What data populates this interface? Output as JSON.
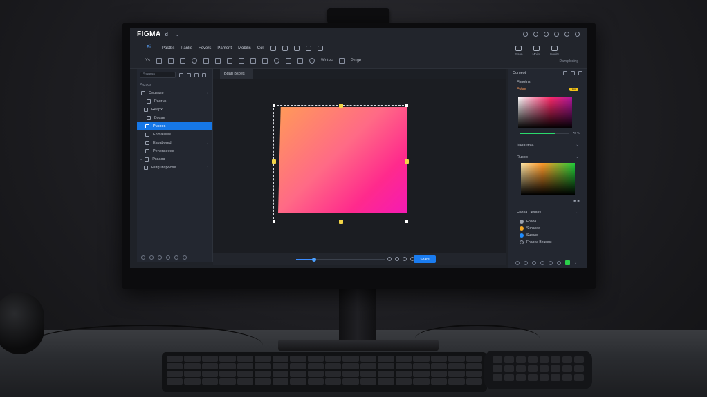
{
  "app": {
    "title": "FIGMA",
    "title_suffix": "d",
    "window_caret": "⌄"
  },
  "toolbar": {
    "home_label": "Fi",
    "menus": [
      "Pastbs",
      "Panlie",
      "Fovers",
      "Pament",
      "Mobilis",
      "Coli"
    ],
    "right_tools": [
      {
        "label": "Prson"
      },
      {
        "label": "Moiss"
      },
      {
        "label": "Nouits"
      }
    ],
    "tool_text_1": "Ys",
    "tool_text_2": "Wotes",
    "tool_text_3": "Pluge",
    "status": "Damiplosing"
  },
  "left_panel": {
    "search_placeholder": "Sseeaa",
    "layers": [
      {
        "label": "Pozoos",
        "selected": false
      },
      {
        "label": "Coucace",
        "selected": false
      },
      {
        "label": "Paorus",
        "selected": false
      },
      {
        "label": "Reapx",
        "selected": false
      },
      {
        "label": "Bosae",
        "selected": false
      },
      {
        "label": "Pucoes",
        "selected": true
      },
      {
        "label": "Ehmauses",
        "selected": false
      },
      {
        "label": "Espabored",
        "selected": false
      },
      {
        "label": "Penonseees",
        "selected": false
      },
      {
        "label": "Pssaoa",
        "selected": false
      },
      {
        "label": "Purgunspoose",
        "selected": false
      }
    ]
  },
  "canvas": {
    "tab_label": "Bdad Bsoes",
    "share_label": "Share",
    "zoom": 0.2
  },
  "right_panel": {
    "header": "Comeot",
    "section_fill": "Fimotns",
    "fill_sub": "Folse",
    "fill_badge": "Fill",
    "picker1_value": "70 %",
    "section_2": "Inunrneca",
    "section_3": "Rucoo",
    "picker2_value": "◉ ◉",
    "section_4": "Fuosa Desass",
    "swatches": [
      {
        "label": "Fnaoa",
        "color": "#9aa0ab"
      },
      {
        "label": "Suoseaa",
        "color": "#f5a623"
      },
      {
        "label": "Subass",
        "color": "#1f8cff"
      },
      {
        "label": "Fhaoea Bnusest",
        "color": "#2b2f36"
      }
    ]
  },
  "colors": {
    "accent": "#1677e6",
    "gradient_start": "#ff9a58",
    "gradient_end": "#f51ab4"
  }
}
